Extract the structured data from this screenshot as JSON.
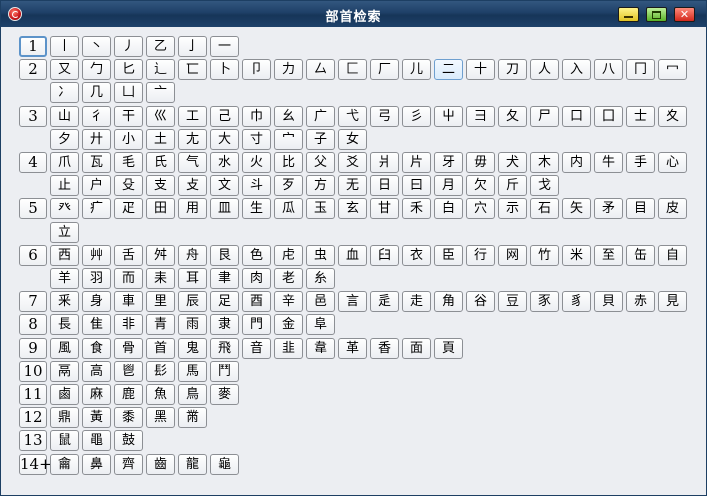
{
  "window": {
    "title": "部首检索"
  },
  "groups": [
    {
      "label": "1",
      "selected": true,
      "lines": [
        [
          "丨",
          "丶",
          "丿",
          "乙",
          "亅",
          "一"
        ]
      ]
    },
    {
      "label": "2",
      "lines": [
        [
          "又",
          "勹",
          "匕",
          "辶",
          "匸",
          "卜",
          "卩",
          "力",
          "厶",
          "匚",
          "厂",
          "儿",
          "二",
          "十",
          "刀",
          "人",
          "入",
          "八",
          "冂",
          "冖"
        ],
        [
          "冫",
          "几",
          "凵",
          "亠"
        ]
      ]
    },
    {
      "label": "3",
      "lines": [
        [
          "山",
          "彳",
          "干",
          "巛",
          "工",
          "己",
          "巾",
          "幺",
          "广",
          "弋",
          "弓",
          "彡",
          "屮",
          "彐",
          "夂",
          "尸",
          "口",
          "囗",
          "士",
          "夊"
        ],
        [
          "夕",
          "廾",
          "小",
          "土",
          "尢",
          "大",
          "寸",
          "宀",
          "子",
          "女"
        ]
      ]
    },
    {
      "label": "4",
      "lines": [
        [
          "爪",
          "瓦",
          "毛",
          "氏",
          "气",
          "水",
          "火",
          "比",
          "父",
          "爻",
          "爿",
          "片",
          "牙",
          "毋",
          "犬",
          "木",
          "内",
          "牛",
          "手",
          "心"
        ],
        [
          "止",
          "户",
          "殳",
          "支",
          "攴",
          "文",
          "斗",
          "歹",
          "方",
          "无",
          "日",
          "曰",
          "月",
          "欠",
          "斤",
          "戈"
        ]
      ]
    },
    {
      "label": "5",
      "lines": [
        [
          "癶",
          "疒",
          "疋",
          "田",
          "用",
          "皿",
          "生",
          "瓜",
          "玉",
          "玄",
          "甘",
          "禾",
          "白",
          "穴",
          "示",
          "石",
          "矢",
          "矛",
          "目",
          "皮"
        ],
        [
          "立"
        ]
      ]
    },
    {
      "label": "6",
      "lines": [
        [
          "西",
          "艸",
          "舌",
          "舛",
          "舟",
          "艮",
          "色",
          "虍",
          "虫",
          "血",
          "臼",
          "衣",
          "臣",
          "行",
          "网",
          "竹",
          "米",
          "至",
          "缶",
          "自"
        ],
        [
          "羊",
          "羽",
          "而",
          "耒",
          "耳",
          "聿",
          "肉",
          "老",
          "糸"
        ]
      ]
    },
    {
      "label": "7",
      "lines": [
        [
          "釆",
          "身",
          "車",
          "里",
          "辰",
          "足",
          "酉",
          "辛",
          "邑",
          "言",
          "辵",
          "走",
          "角",
          "谷",
          "豆",
          "豕",
          "豸",
          "貝",
          "赤",
          "見"
        ]
      ]
    },
    {
      "label": "8",
      "lines": [
        [
          "長",
          "隹",
          "非",
          "青",
          "雨",
          "隶",
          "門",
          "金",
          "阜"
        ]
      ]
    },
    {
      "label": "9",
      "lines": [
        [
          "風",
          "食",
          "骨",
          "首",
          "鬼",
          "飛",
          "音",
          "韭",
          "韋",
          "革",
          "香",
          "面",
          "頁"
        ]
      ]
    },
    {
      "label": "10",
      "lines": [
        [
          "鬲",
          "高",
          "鬯",
          "髟",
          "馬",
          "鬥"
        ]
      ]
    },
    {
      "label": "11",
      "lines": [
        [
          "鹵",
          "麻",
          "鹿",
          "魚",
          "鳥",
          "麥"
        ]
      ]
    },
    {
      "label": "12",
      "lines": [
        [
          "鼎",
          "黃",
          "黍",
          "黑",
          "黹"
        ]
      ]
    },
    {
      "label": "13",
      "lines": [
        [
          "鼠",
          "黽",
          "鼓"
        ]
      ]
    },
    {
      "label": "14+",
      "lines": [
        [
          "龠",
          "鼻",
          "齊",
          "齒",
          "龍",
          "龜"
        ]
      ]
    }
  ]
}
